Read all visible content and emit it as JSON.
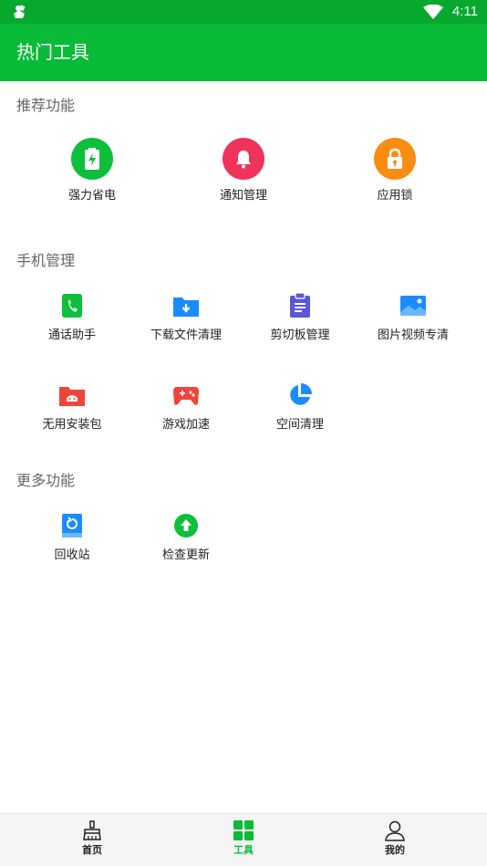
{
  "status_bar": {
    "time": "4:11",
    "left_icon": "android-icon",
    "wifi_icon": "wifi-icon"
  },
  "app_bar": {
    "title": "热门工具"
  },
  "colors": {
    "primary": "#09bb37",
    "status_bar": "#06a92e",
    "battery": "#0dbf3a",
    "notify": "#f0335b",
    "lock": "#fb8c12",
    "blue": "#1a8cff",
    "purple": "#5b57d9",
    "red": "#f0443b"
  },
  "sections": [
    {
      "title": "推荐功能",
      "items": [
        {
          "label": "强力省电",
          "icon": "battery-saver-icon"
        },
        {
          "label": "通知管理",
          "icon": "bell-icon"
        },
        {
          "label": "应用锁",
          "icon": "lock-icon"
        }
      ]
    },
    {
      "title": "手机管理",
      "items": [
        {
          "label": "通话助手",
          "icon": "phone-icon"
        },
        {
          "label": "下载文件清理",
          "icon": "download-folder-icon"
        },
        {
          "label": "剪切板管理",
          "icon": "clipboard-icon"
        },
        {
          "label": "图片视频专清",
          "icon": "image-icon"
        },
        {
          "label": "无用安装包",
          "icon": "android-package-icon"
        },
        {
          "label": "游戏加速",
          "icon": "gamepad-icon"
        },
        {
          "label": "空间清理",
          "icon": "pie-chart-icon"
        }
      ]
    },
    {
      "title": "更多功能",
      "items": [
        {
          "label": "回收站",
          "icon": "recycle-bin-icon"
        },
        {
          "label": "检查更新",
          "icon": "update-arrow-icon"
        }
      ]
    }
  ],
  "bottom_nav": [
    {
      "label": "首页",
      "icon": "broom-icon",
      "active": false
    },
    {
      "label": "工具",
      "icon": "grid-icon",
      "active": true
    },
    {
      "label": "我的",
      "icon": "person-icon",
      "active": false
    }
  ]
}
